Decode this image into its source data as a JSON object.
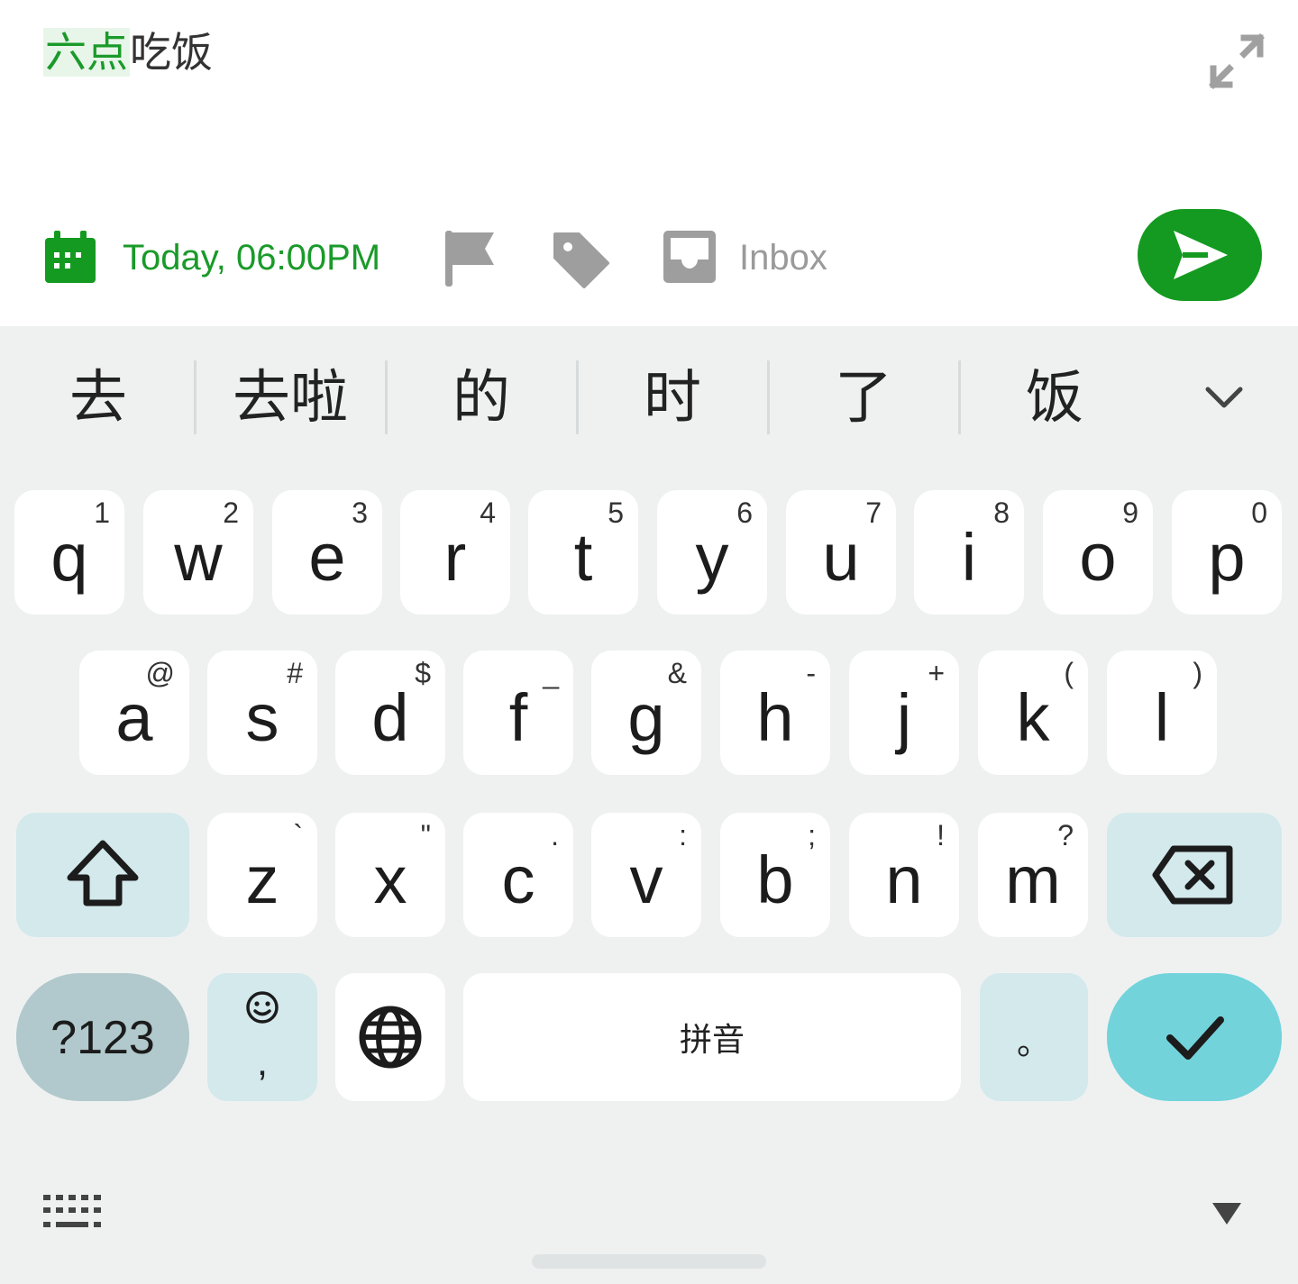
{
  "task": {
    "highlight_text": "六点",
    "rest_text": "吃饭"
  },
  "toolbar": {
    "date_label": "Today, 06:00PM",
    "list_label": "Inbox",
    "icons": [
      "calendar-icon",
      "flag-icon",
      "tag-icon",
      "inbox-icon",
      "send-icon",
      "expand-icon"
    ]
  },
  "candidates": [
    "去",
    "去啦",
    "的",
    "时",
    "了",
    "饭"
  ],
  "keyboard": {
    "row1": [
      {
        "key": "q",
        "hint": "1"
      },
      {
        "key": "w",
        "hint": "2"
      },
      {
        "key": "e",
        "hint": "3"
      },
      {
        "key": "r",
        "hint": "4"
      },
      {
        "key": "t",
        "hint": "5"
      },
      {
        "key": "y",
        "hint": "6"
      },
      {
        "key": "u",
        "hint": "7"
      },
      {
        "key": "i",
        "hint": "8"
      },
      {
        "key": "o",
        "hint": "9"
      },
      {
        "key": "p",
        "hint": "0"
      }
    ],
    "row2": [
      {
        "key": "a",
        "hint": "@"
      },
      {
        "key": "s",
        "hint": "#"
      },
      {
        "key": "d",
        "hint": "$"
      },
      {
        "key": "f",
        "hint": "_"
      },
      {
        "key": "g",
        "hint": "&"
      },
      {
        "key": "h",
        "hint": "-"
      },
      {
        "key": "j",
        "hint": "+"
      },
      {
        "key": "k",
        "hint": "("
      },
      {
        "key": "l",
        "hint": ")"
      }
    ],
    "row3": [
      {
        "key": "z",
        "hint": "`"
      },
      {
        "key": "x",
        "hint": "\""
      },
      {
        "key": "c",
        "hint": "."
      },
      {
        "key": "v",
        "hint": ":"
      },
      {
        "key": "b",
        "hint": ";"
      },
      {
        "key": "n",
        "hint": "!"
      },
      {
        "key": "m",
        "hint": "?"
      }
    ],
    "symbols_label": "?123",
    "comma_label": ",",
    "space_label": "拼音",
    "period_label": "。"
  },
  "colors": {
    "accent_green": "#149a20",
    "key_bg": "#ffffff",
    "fn_key_bg": "#d3e9ec",
    "enter_bg": "#72d3db",
    "keyboard_bg": "#eff1f1"
  }
}
